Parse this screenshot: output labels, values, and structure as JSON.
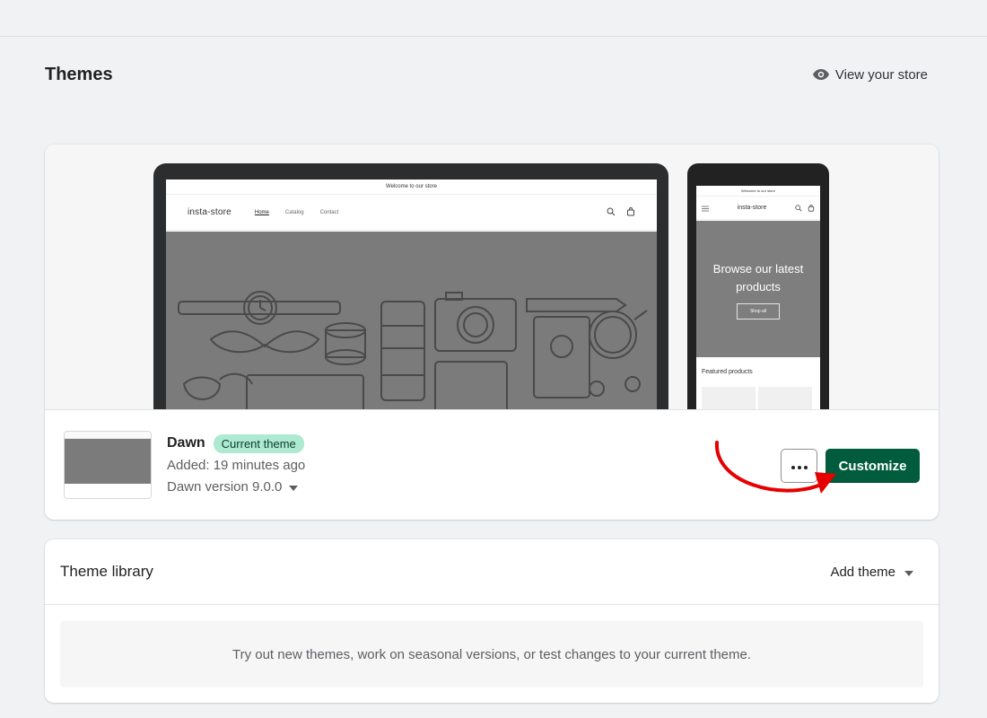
{
  "header": {
    "title": "Themes",
    "view_store": "View your store"
  },
  "preview": {
    "desktop": {
      "announcement": "Welcome to our store",
      "logo": "insta-store",
      "nav": [
        "Home",
        "Catalog",
        "Contact"
      ]
    },
    "mobile": {
      "announcement": "Welcome to our store",
      "logo": "insta-store",
      "hero_text": "Browse our latest products",
      "hero_button": "Shop all",
      "featured": "Featured products"
    }
  },
  "current_theme": {
    "name": "Dawn",
    "badge": "Current theme",
    "added": "Added: 19 minutes ago",
    "version": "Dawn version 9.0.0",
    "more_label": "•••",
    "customize_label": "Customize"
  },
  "library": {
    "title": "Theme library",
    "add_theme": "Add theme",
    "empty_text": "Try out new themes, work on seasonal versions, or test changes to your current theme."
  },
  "colors": {
    "primary": "#005c3d",
    "badge_bg": "#aee9d1",
    "annotation": "#e60000"
  }
}
